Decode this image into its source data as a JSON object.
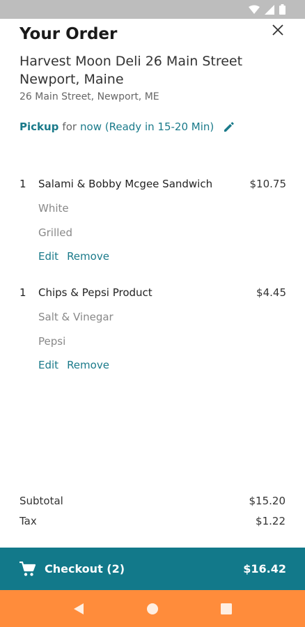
{
  "header": {
    "title": "Your Order",
    "store_name": "Harvest Moon Deli 26 Main Street Newport, Maine",
    "store_address": "26 Main Street, Newport, ME"
  },
  "pickup": {
    "method": "Pickup",
    "for_label": "for",
    "time": "now (Ready in 15-20 Min)"
  },
  "items": [
    {
      "qty": "1",
      "name": "Salami & Bobby Mcgee Sandwich",
      "price": "$10.75",
      "options": [
        "White",
        "Grilled"
      ],
      "edit_label": "Edit",
      "remove_label": "Remove"
    },
    {
      "qty": "1",
      "name": "Chips & Pepsi Product",
      "price": "$4.45",
      "options": [
        "Salt & Vinegar",
        "Pepsi"
      ],
      "edit_label": "Edit",
      "remove_label": "Remove"
    }
  ],
  "totals": {
    "subtotal_label": "Subtotal",
    "subtotal_value": "$15.20",
    "tax_label": "Tax",
    "tax_value": "$1.22"
  },
  "checkout": {
    "label": "Checkout (2)",
    "total": "$16.42"
  },
  "colors": {
    "accent": "#1a7a8a",
    "checkout_bg": "#12798a",
    "nav_bg": "#ff8c3b",
    "status_bg": "#bdbdbd"
  },
  "icons": {
    "close": "close-icon",
    "edit_pickup": "pencil-icon",
    "cart": "cart-icon",
    "back": "back-triangle-icon",
    "home": "home-circle-icon",
    "recents": "recents-square-icon"
  }
}
